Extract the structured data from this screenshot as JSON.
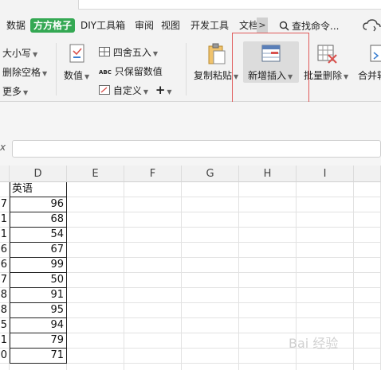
{
  "menu": {
    "items": [
      "数据",
      "方方格子",
      "DIY工具箱",
      "审阅",
      "视图",
      "开发工具",
      "文档"
    ],
    "active_index": 1,
    "scroll_glyph": ">",
    "search_label": "查找命令..."
  },
  "ribbon": {
    "case_label": "大小写",
    "remove_space_label": "删除空格",
    "more_label": "更多",
    "value_label": "数值",
    "round_label": "四舍五入",
    "keep_value_label": "只保留数值",
    "custom_label": "自定义",
    "plus_glyph": "+",
    "copy_paste_label": "复制粘贴",
    "insert_new_label": "新增插入",
    "batch_delete_label": "批量删除",
    "merge_label": "合并转",
    "abc_glyph": "ABC"
  },
  "formula_bar": {
    "fx_label": "x",
    "value": ""
  },
  "sheet": {
    "columns": [
      "D",
      "E",
      "F",
      "G",
      "H",
      "I"
    ],
    "header_cell": "英语",
    "row_stub": [
      "7",
      "1",
      "1",
      "6",
      "6",
      "7",
      "8",
      "8",
      "5",
      "1",
      "0"
    ],
    "d_values": [
      "96",
      "68",
      "54",
      "67",
      "99",
      "50",
      "91",
      "95",
      "94",
      "79",
      "71"
    ]
  },
  "watermark": "Bai 经验"
}
